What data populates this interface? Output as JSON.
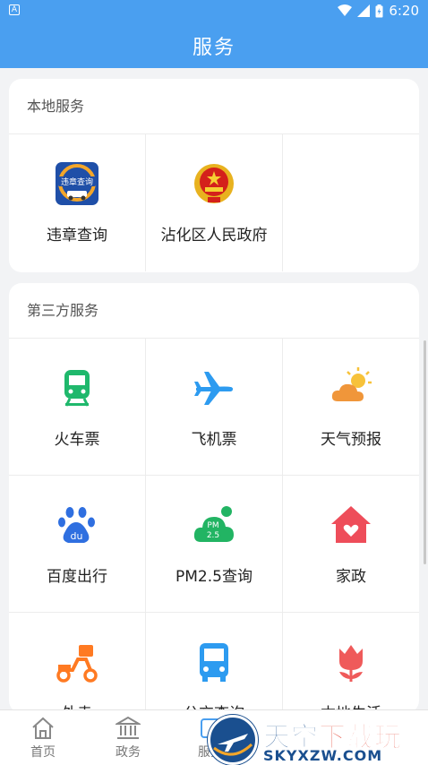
{
  "statusbar": {
    "time": "6:20",
    "notif_icon": "A"
  },
  "appbar": {
    "title": "服务"
  },
  "local": {
    "title": "本地服务",
    "items": [
      {
        "label": "违章查询",
        "icon": "traffic-violation-icon"
      },
      {
        "label": "沾化区人民政府",
        "icon": "government-emblem-icon"
      }
    ]
  },
  "third": {
    "title": "第三方服务",
    "items": [
      {
        "label": "火车票",
        "icon": "train-icon",
        "color": "#1fb86c"
      },
      {
        "label": "飞机票",
        "icon": "airplane-icon",
        "color": "#2d9bf0"
      },
      {
        "label": "天气预报",
        "icon": "weather-icon",
        "color": "#f0a33a"
      },
      {
        "label": "百度出行",
        "icon": "baidu-icon",
        "color": "#2f6fe0"
      },
      {
        "label": "PM2.5查询",
        "icon": "pm25-icon",
        "color": "#22b463",
        "icon_text": "PM\n2.5"
      },
      {
        "label": "家政",
        "icon": "house-icon",
        "color": "#ee4d5a"
      },
      {
        "label": "外卖",
        "icon": "scooter-icon",
        "color": "#ff7a22"
      },
      {
        "label": "公交查询",
        "icon": "bus-icon",
        "color": "#2d9bf0"
      },
      {
        "label": "本地生活",
        "icon": "tulip-icon",
        "color": "#ef5a5a"
      }
    ]
  },
  "nav": [
    {
      "label": "首页",
      "icon": "home-icon"
    },
    {
      "label": "政务",
      "icon": "government-building-icon"
    },
    {
      "label": "服务",
      "icon": "service-icon"
    }
  ],
  "watermark": {
    "line1a": "天空",
    "line1b": "下载玩",
    "line2": "SKYXZW.COM"
  },
  "colors": {
    "primary": "#4a9ff0",
    "background": "#f2f3f5"
  }
}
